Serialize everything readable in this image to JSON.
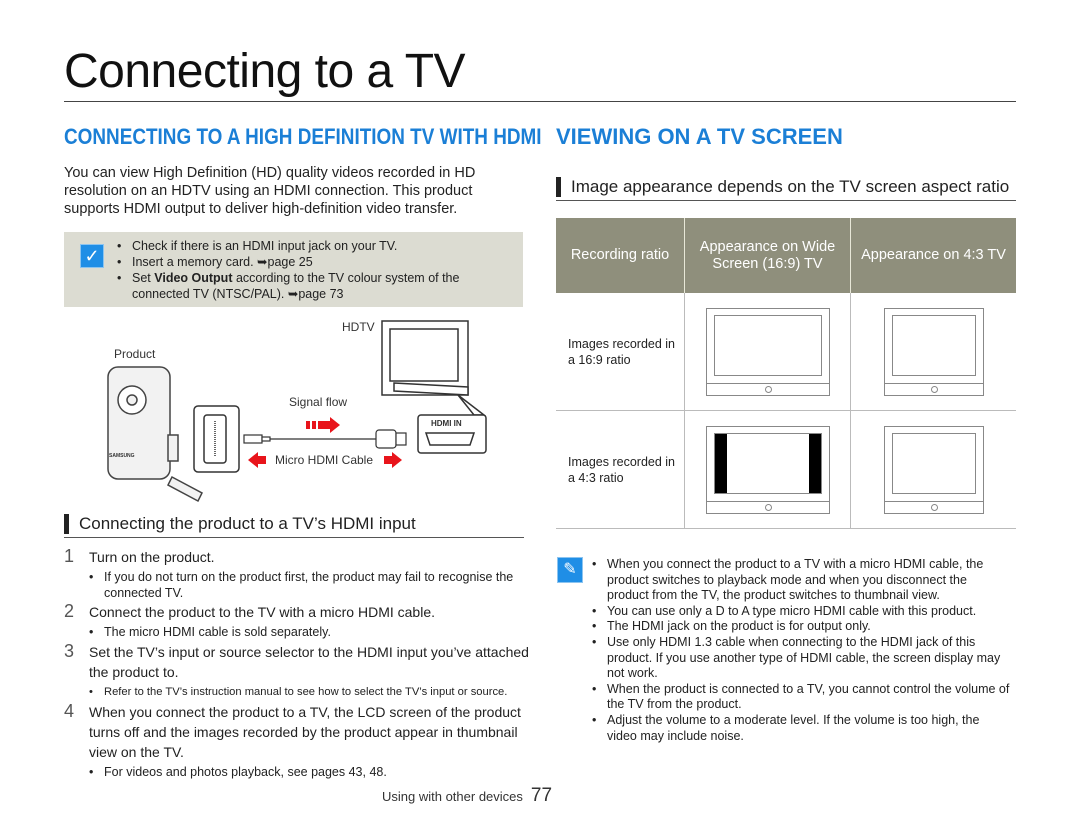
{
  "title": "Connecting to a TV",
  "left": {
    "heading": "CONNECTING TO A HIGH DEFINITION TV WITH HDMI",
    "intro": "You can view High Definition (HD) quality videos recorded in HD resolution on an HDTV using an HDMI connection. This product supports HDMI output to deliver high-definition video transfer.",
    "checklist": {
      "icon": "checkmark-icon",
      "items": [
        {
          "text": "Check if there is an HDMI input jack on your TV."
        },
        {
          "text": "Insert a memory card. ➥page 25"
        },
        {
          "pre": "Set ",
          "bold": "Video Output",
          "post": " according to the TV colour system of the connected TV (NTSC/PAL). ➥page 73"
        }
      ]
    },
    "diagram": {
      "hdtv": "HDTV",
      "product": "Product",
      "signal_flow": "Signal flow",
      "hdmi_in": "HDMI IN",
      "cable": "Micro HDMI Cable",
      "brand": "SAMSUNG",
      "arrow_color": "#e8141b"
    },
    "subheading": "Connecting the product to a TV’s HDMI input",
    "steps": [
      {
        "num": "1",
        "text": "Turn on the product.",
        "notes": [
          "If you do not turn on the product first, the product may fail to recognise the connected TV."
        ]
      },
      {
        "num": "2",
        "text": "Connect the product to the TV with a micro HDMI cable.",
        "notes": [
          "The micro HDMI cable is sold separately."
        ]
      },
      {
        "num": "3",
        "text": "Set the TV’s input or source selector to the HDMI input you’ve attached the product to.",
        "notes": [
          "Refer to the TV’s instruction manual to see how to select the TV’s input or source."
        ]
      },
      {
        "num": "4",
        "text": "When you connect the product to a TV, the LCD screen of the product turns off and the images recorded by the product appear in thumbnail view on the TV.",
        "notes": [
          "For videos and photos playback, see pages 43, 48."
        ]
      }
    ]
  },
  "right": {
    "heading": "VIEWING ON A TV SCREEN",
    "subheading": "Image appearance depends on the TV screen aspect ratio",
    "table": {
      "headers": [
        "Recording ratio",
        "Appearance on Wide Screen (16:9) TV",
        "Appearance on 4:3 TV"
      ],
      "rows": [
        {
          "label": "Images recorded in a 16:9 ratio"
        },
        {
          "label": "Images recorded in a 4:3 ratio"
        }
      ]
    },
    "notes": {
      "icon": "pencil-note-icon",
      "items": [
        "When you connect the product to a TV with a micro HDMI cable, the product switches to playback mode and when you disconnect the product from the TV, the product switches to thumbnail view.",
        "You can use only a D to A type micro HDMI cable with this product.",
        "The HDMI jack on the product is for output only.",
        "Use only HDMI 1.3 cable when connecting to the HDMI jack of this product. If you use another type of HDMI cable, the screen display may not work.",
        "When the product is connected to a TV, you cannot control the volume of the TV from the product.",
        "Adjust the volume to a moderate level. If the volume is too high, the video may include noise."
      ]
    }
  },
  "footer": {
    "section": "Using with other devices",
    "page": "77"
  },
  "colors": {
    "heading_blue": "#1b7fd6",
    "table_header": "#8f8f7c",
    "check_box_bg": "#dcdcd2"
  }
}
